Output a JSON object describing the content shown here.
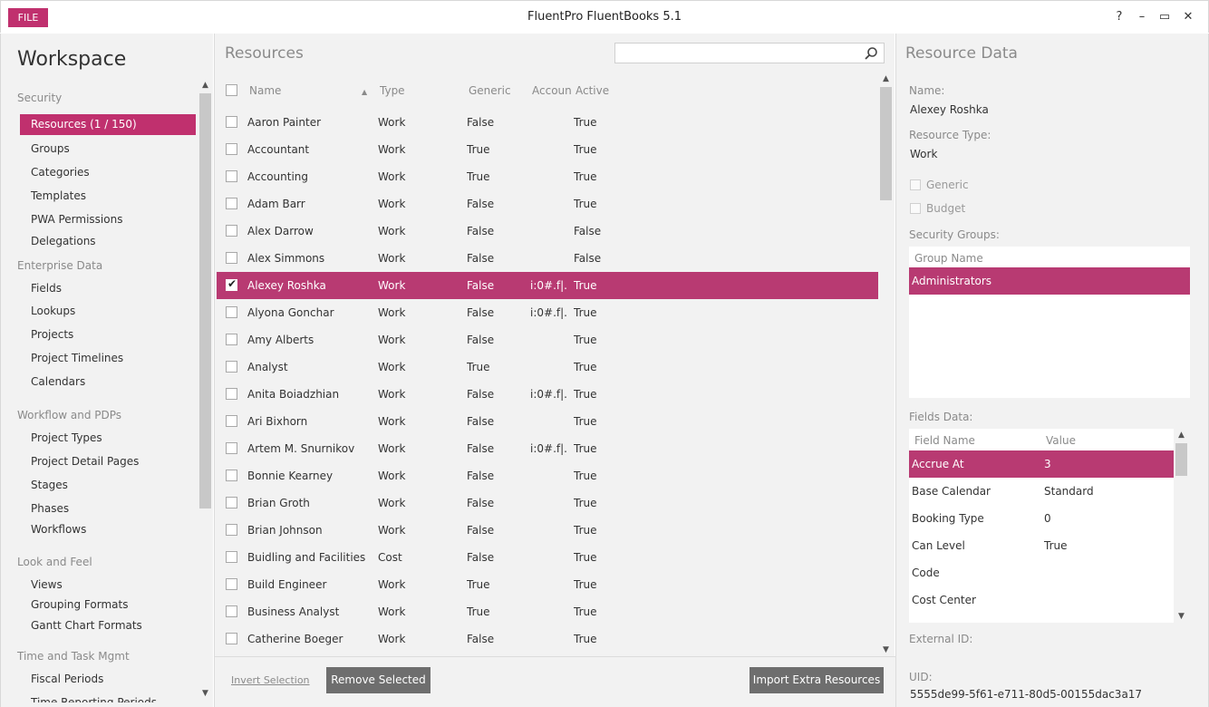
{
  "app": {
    "file_label": "FILE",
    "title": "FluentPro FluentBooks 5.1",
    "help": "?",
    "minimize": "–",
    "restore": "▭",
    "close": "✕"
  },
  "workspace": {
    "title": "Workspace",
    "groups": [
      {
        "label": "Security",
        "items": [
          "Resources (1 / 150)",
          "Groups",
          "Categories",
          "Templates",
          "PWA Permissions",
          "Delegations"
        ]
      },
      {
        "label": "Enterprise Data",
        "items": [
          "Fields",
          "Lookups",
          "Projects",
          "Project Timelines",
          "Calendars"
        ]
      },
      {
        "label": "Workflow and PDPs",
        "items": [
          "Project Types",
          "Project Detail Pages",
          "Stages",
          "Phases",
          "Workflows"
        ]
      },
      {
        "label": "Look and Feel",
        "items": [
          "Views",
          "Grouping Formats",
          "Gantt Chart Formats"
        ]
      },
      {
        "label": "Time and Task Mgmt",
        "items": [
          "Fiscal Periods",
          "Time Reporting Periods"
        ]
      }
    ]
  },
  "resources": {
    "title": "Resources",
    "search_placeholder": "",
    "columns": [
      "Name",
      "Type",
      "Generic",
      "Account",
      "Active"
    ],
    "rows": [
      [
        "Aaron Painter",
        "Work",
        "False",
        "",
        "True"
      ],
      [
        "Accountant",
        "Work",
        "True",
        "",
        "True"
      ],
      [
        "Accounting",
        "Work",
        "True",
        "",
        "True"
      ],
      [
        "Adam Barr",
        "Work",
        "False",
        "",
        "True"
      ],
      [
        "Alex Darrow",
        "Work",
        "False",
        "",
        "False"
      ],
      [
        "Alex Simmons",
        "Work",
        "False",
        "",
        "False"
      ],
      [
        "Alexey Roshka",
        "Work",
        "False",
        "i:0#.f|...",
        "True"
      ],
      [
        "Alyona Gonchar",
        "Work",
        "False",
        "i:0#.f|...",
        "True"
      ],
      [
        "Amy Alberts",
        "Work",
        "False",
        "",
        "True"
      ],
      [
        "Analyst",
        "Work",
        "True",
        "",
        "True"
      ],
      [
        "Anita Boiadzhian",
        "Work",
        "False",
        "i:0#.f|...",
        "True"
      ],
      [
        "Ari Bixhorn",
        "Work",
        "False",
        "",
        "True"
      ],
      [
        "Artem M. Snurnikov",
        "Work",
        "False",
        "i:0#.f|...",
        "True"
      ],
      [
        "Bonnie Kearney",
        "Work",
        "False",
        "",
        "True"
      ],
      [
        "Brian Groth",
        "Work",
        "False",
        "",
        "True"
      ],
      [
        "Brian Johnson",
        "Work",
        "False",
        "",
        "True"
      ],
      [
        "Buidling and Facilities",
        "Cost",
        "False",
        "",
        "True"
      ],
      [
        "Build Engineer",
        "Work",
        "True",
        "",
        "True"
      ],
      [
        "Business Analyst",
        "Work",
        "True",
        "",
        "True"
      ],
      [
        "Catherine Boeger",
        "Work",
        "False",
        "",
        "True"
      ]
    ],
    "selected_row": 6,
    "invert_label": "Invert Selection",
    "remove_label": "Remove Selected",
    "import_label": "Import Extra Resources"
  },
  "resource_data": {
    "title": "Resource Data",
    "name_label": "Name:",
    "name_value": "Alexey Roshka",
    "type_label": "Resource Type:",
    "type_value": "Work",
    "generic_label": "Generic",
    "budget_label": "Budget",
    "security_groups_label": "Security Groups:",
    "group_name_header": "Group Name",
    "groups": [
      "Administrators"
    ],
    "fields_label": "Fields Data:",
    "field_name_header": "Field Name",
    "value_header": "Value",
    "fields": [
      [
        "Accrue At",
        "3"
      ],
      [
        "Base Calendar",
        "Standard"
      ],
      [
        "Booking Type",
        "0"
      ],
      [
        "Can Level",
        "True"
      ],
      [
        "Code",
        ""
      ],
      [
        "Cost Center",
        ""
      ]
    ],
    "external_id_label": "External ID:",
    "uid_label": "UID:",
    "uid_value": "5555de99-5f61-e711-80d5-00155dac3a17"
  },
  "colors": {
    "accent": "#c0306e",
    "selected_row": "#b83a72",
    "panel_bg": "#f2f2f2",
    "button_gray": "#6e6e6e"
  }
}
